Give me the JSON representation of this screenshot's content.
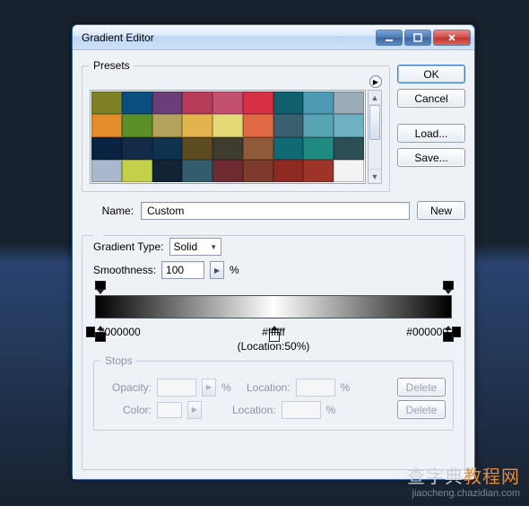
{
  "window": {
    "title": "Gradient Editor"
  },
  "buttons": {
    "ok": "OK",
    "cancel": "Cancel",
    "load": "Load...",
    "save": "Save...",
    "new": "New",
    "delete": "Delete"
  },
  "presets": {
    "legend": "Presets",
    "swatches": [
      "#7e8224",
      "#0a4f7e",
      "#6a3f79",
      "#b63c58",
      "#c4506f",
      "#d83044",
      "#0f5f6e",
      "#4c9ab4",
      "#9aacb8",
      "#e28c2b",
      "#5c8f2a",
      "#b3a35a",
      "#e3b34d",
      "#e3d977",
      "#e06a46",
      "#3a5f6e",
      "#58a3b4",
      "#6db1c2",
      "#0a2340",
      "#132b49",
      "#0f324e",
      "#5c4b21",
      "#3e3b2f",
      "#8e5a3a",
      "#0f6a73",
      "#1f8a80",
      "#2b4f55",
      "#a9b8cd",
      "#c3d04a",
      "#112334",
      "#355c6d",
      "#6e2c32",
      "#7e3a2c",
      "#8e2a22",
      "#9d3427",
      "#f3f3f3"
    ]
  },
  "name": {
    "label": "Name:",
    "value": "Custom"
  },
  "gradient": {
    "type_label": "Gradient Type:",
    "type_value": "Solid",
    "smoothness_label": "Smoothness:",
    "smoothness_value": "100",
    "percent": "%",
    "stops": [
      {
        "position": 0,
        "color": "#000000"
      },
      {
        "position": 50,
        "color": "#ffffff"
      },
      {
        "position": 100,
        "color": "#000000"
      }
    ],
    "hex_left": "#000000",
    "hex_mid": "#ffffff",
    "hex_right": "#000000",
    "loc_note": "(Location:50%)"
  },
  "stops_panel": {
    "legend": "Stops",
    "opacity_label": "Opacity:",
    "color_label": "Color:",
    "location_label": "Location:"
  },
  "watermark": {
    "cn_prefix": "查字典",
    "cn_suffix": "教程网",
    "url": "jiaocheng.chazidian.com"
  }
}
